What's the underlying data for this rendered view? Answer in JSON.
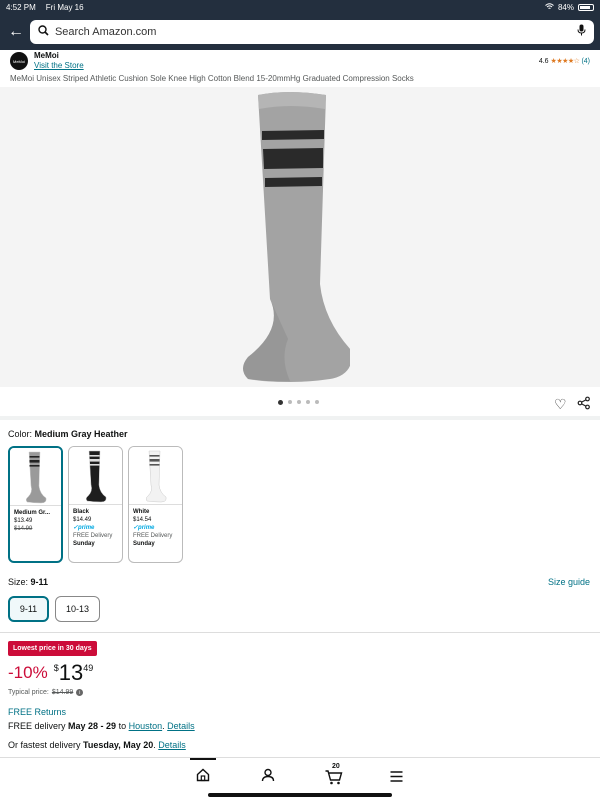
{
  "status_bar": {
    "time": "4:52 PM",
    "date": "Fri May 16",
    "battery": "84%"
  },
  "search": {
    "placeholder": "Search Amazon.com"
  },
  "store": {
    "logo_text": "MeMoi",
    "name": "MeMoi",
    "link": "Visit the Store"
  },
  "rating": {
    "value": "4.6",
    "stars": "★★★★☆",
    "count": "(4)"
  },
  "product": {
    "title": "MeMoi Unisex Striped Athletic Cushion Sole Knee High Cotton Blend 15-20mmHg Graduated Compression Socks"
  },
  "carousel": {
    "dot_count": 5,
    "active_index": 0
  },
  "color": {
    "label": "Color:",
    "selected": "Medium Gray Heather",
    "options": [
      {
        "name": "Medium Gr...",
        "price": "$13.49",
        "list_price": "$14.99",
        "prime": "",
        "delivery": "",
        "delivery_day": "",
        "sock_color": "#9a9a9a",
        "stripe_color": "#222222"
      },
      {
        "name": "Black",
        "price": "$14.49",
        "list_price": "",
        "prime": "✓prime",
        "delivery": "FREE Delivery",
        "delivery_day": "Sunday",
        "sock_color": "#1e1e1e",
        "stripe_color": "#dddddd"
      },
      {
        "name": "White",
        "price": "$14.54",
        "list_price": "",
        "prime": "✓prime",
        "delivery": "FREE Delivery",
        "delivery_day": "Sunday",
        "sock_color": "#f2f2f2",
        "stripe_color": "#555555"
      }
    ]
  },
  "size": {
    "label": "Size:",
    "selected": "9-11",
    "guide": "Size guide",
    "options": [
      "9-11",
      "10-13"
    ]
  },
  "deal": {
    "badge": "Lowest price in 30 days",
    "discount": "-10%",
    "currency": "$",
    "whole": "13",
    "fraction": "49",
    "typical_label": "Typical price:",
    "typical_price": "$14.99",
    "info_icon": "i"
  },
  "delivery": {
    "returns": "FREE Returns",
    "free_prefix": "FREE delivery",
    "free_dates": "May 28 - 29",
    "to": "to",
    "city": "Houston",
    "period": ".",
    "details": "Details",
    "fastest_prefix": "Or fastest delivery",
    "fastest_date": "Tuesday, May 20",
    "fastest_period": "."
  },
  "nav": {
    "cart_count": "20"
  },
  "colors": {
    "header_bg": "#232f3e",
    "link": "#007185",
    "deal_red": "#cc0c39",
    "star": "#de7921"
  }
}
